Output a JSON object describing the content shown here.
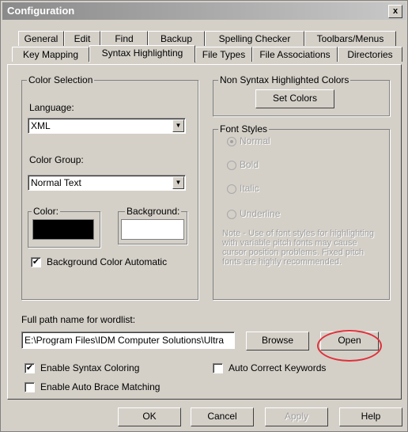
{
  "window": {
    "title": "Configuration",
    "close_glyph": "x"
  },
  "tabs_row1": [
    "General",
    "Edit",
    "Find",
    "Backup",
    "Spelling Checker",
    "Toolbars/Menus"
  ],
  "tabs_row2": [
    "Key Mapping",
    "Syntax Highlighting",
    "File Types",
    "File Associations",
    "Directories"
  ],
  "active_tab": "Syntax Highlighting",
  "color_selection": {
    "group_label": "Color Selection",
    "language_label": "Language:",
    "language_value": "XML",
    "color_group_label": "Color Group:",
    "color_group_value": "Normal Text",
    "color_label": "Color:",
    "background_label": "Background:",
    "color_swatch": "#000000",
    "background_swatch": "#ffffff",
    "bg_auto_label": "Background Color Automatic",
    "bg_auto_checked": true
  },
  "non_syntax": {
    "group_label": "Non Syntax Highlighted Colors",
    "set_colors_button": "Set Colors"
  },
  "font_styles": {
    "group_label": "Font Styles",
    "options": [
      "Normal",
      "Bold",
      "Italic",
      "Underline"
    ],
    "selected": "Normal",
    "note": "Note - Use of font styles for highlighting with variable pitch fonts may cause cursor position problems. Fixed pitch fonts are highly recommended."
  },
  "wordlist": {
    "label": "Full path name for wordlist:",
    "path": "E:\\Program Files\\IDM Computer Solutions\\Ultra",
    "browse_button": "Browse",
    "open_button": "Open"
  },
  "options": {
    "enable_syntax_coloring": "Enable Syntax Coloring",
    "enable_syntax_coloring_checked": true,
    "auto_correct_keywords": "Auto Correct Keywords",
    "auto_correct_keywords_checked": false,
    "auto_brace_matching": "Enable Auto Brace Matching",
    "auto_brace_matching_checked": false
  },
  "footer": {
    "ok": "OK",
    "cancel": "Cancel",
    "apply": "Apply",
    "help": "Help"
  },
  "highlight_color": "#e0303a"
}
